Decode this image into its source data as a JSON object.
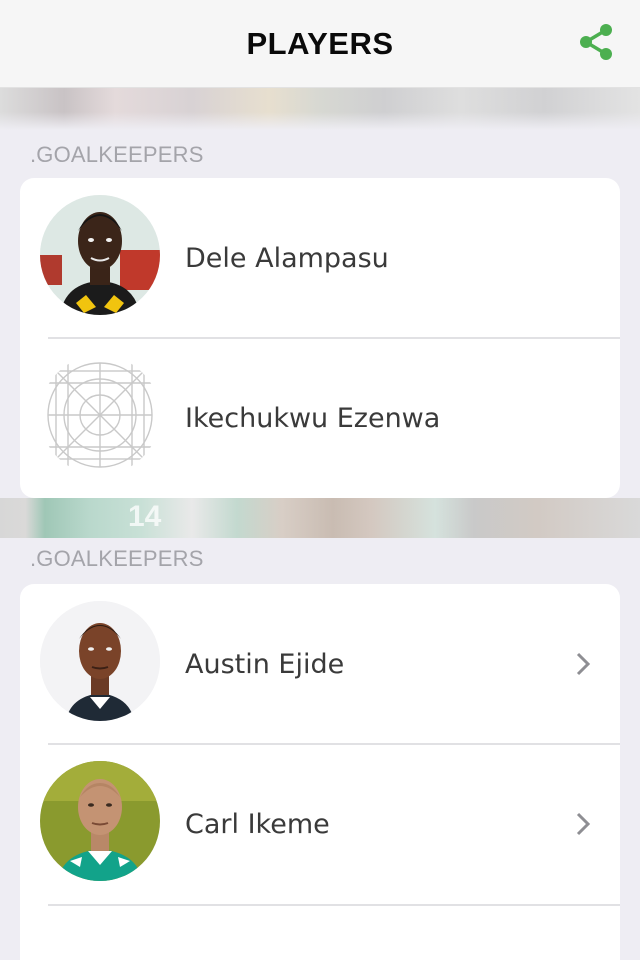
{
  "header": {
    "title": "PLAYERS",
    "share_icon": "share-icon",
    "accent_color": "#4caf50"
  },
  "banners": {
    "jersey_number": "14"
  },
  "sections": [
    {
      "label": ".GOALKEEPERS",
      "players": [
        {
          "name": "Dele Alampasu",
          "avatar": "player-photo",
          "has_chevron": false
        },
        {
          "name": "Ikechukwu Ezenwa",
          "avatar": "placeholder-avatar-icon",
          "has_chevron": false
        }
      ]
    },
    {
      "label": ".GOALKEEPERS",
      "players": [
        {
          "name": "Austin Ejide",
          "avatar": "player-photo",
          "has_chevron": true
        },
        {
          "name": "Carl Ikeme",
          "avatar": "player-photo",
          "has_chevron": true
        }
      ]
    }
  ]
}
